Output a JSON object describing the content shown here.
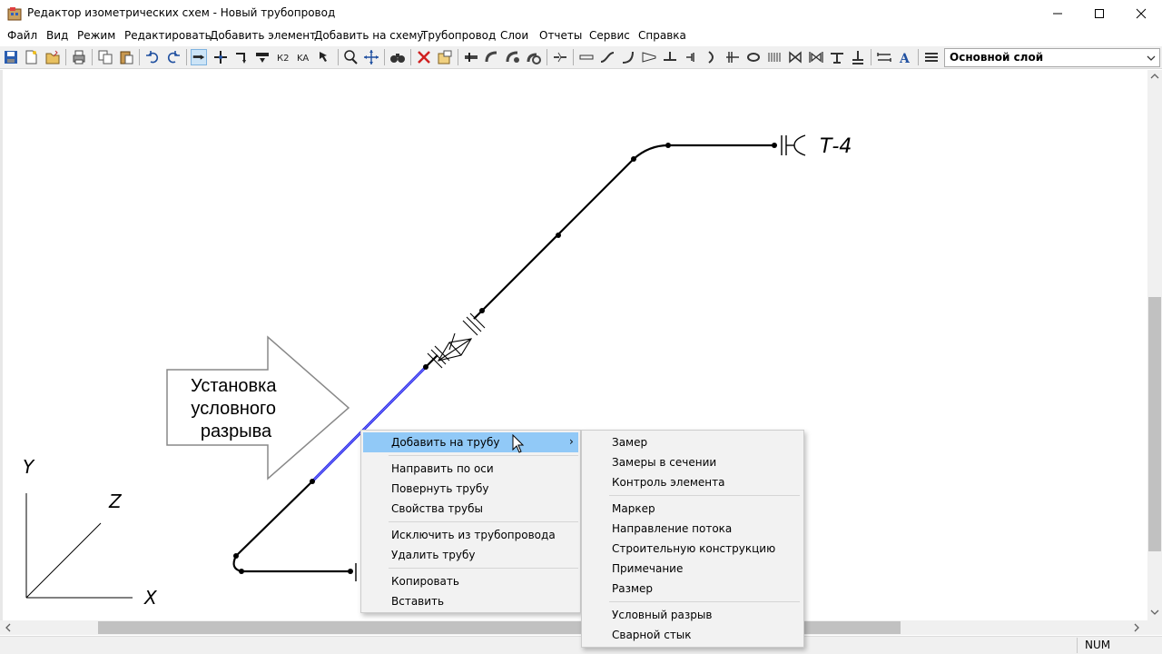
{
  "window": {
    "title": "Редактор изометрических схем - Новый трубопровод",
    "minimize": "–",
    "maximize": "☐",
    "close": "✕"
  },
  "menu": [
    "Файл",
    "Вид",
    "Режим",
    "Редактировать",
    "Добавить элемент",
    "Добавить на схему",
    "Трубопровод",
    "Слои",
    "Отчеты",
    "Сервис",
    "Справка"
  ],
  "toolbar": {
    "layer_select": "Основной слой",
    "active_tool": "select-pipe-tool"
  },
  "drawing": {
    "pipe_label": "Т-4",
    "callout_lines": [
      "Установка",
      "условного",
      "разрыва"
    ],
    "axes": {
      "y": "Y",
      "z": "Z",
      "x": "X"
    },
    "highlight_color": "#1e1ee6",
    "pipe_color": "#000000"
  },
  "context_menu": {
    "items": [
      {
        "label": "Добавить на трубу",
        "submenu_arrow": "›",
        "highlighted": true
      },
      {
        "label": "Направить по оси"
      },
      {
        "label": "Повернуть трубу"
      },
      {
        "label": "Свойства трубы"
      },
      {
        "label": "Исключить из трубопровода"
      },
      {
        "label": "Удалить трубу"
      },
      {
        "label": "Копировать"
      },
      {
        "label": "Вставить"
      }
    ]
  },
  "submenu": {
    "items": [
      {
        "label": "Замер"
      },
      {
        "label": "Замеры в сечении"
      },
      {
        "label": "Контроль элемента"
      },
      {
        "label": "Маркер"
      },
      {
        "label": "Направление потока"
      },
      {
        "label": "Строительную конструкцию"
      },
      {
        "label": "Примечание"
      },
      {
        "label": "Размер"
      },
      {
        "label": "Условный разрыв"
      },
      {
        "label": "Сварной стык"
      }
    ]
  },
  "statusbar": {
    "num": "NUM"
  }
}
